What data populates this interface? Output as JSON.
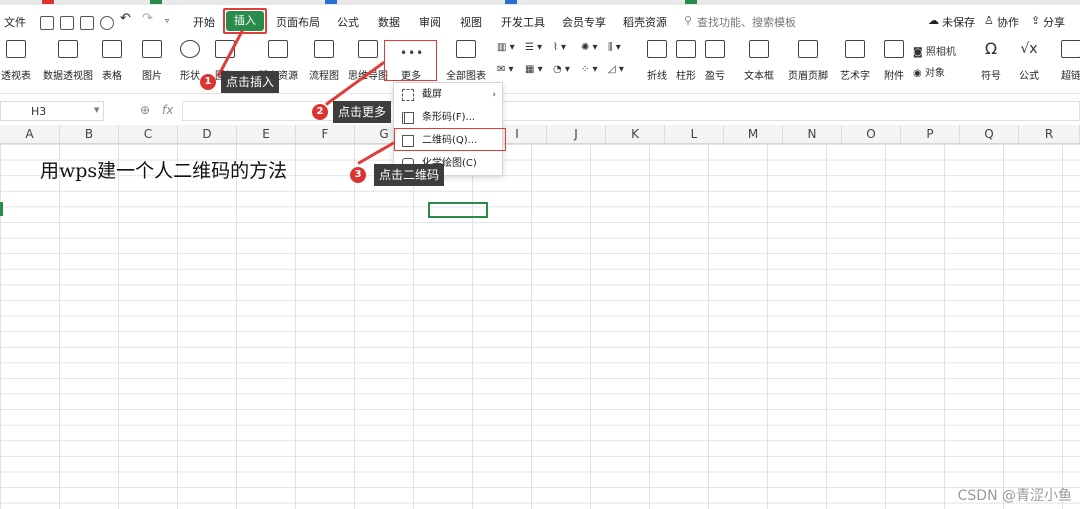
{
  "menu": {
    "file": "文件",
    "start": "开始",
    "insert": "插入",
    "page_layout": "页面布局",
    "formula": "公式",
    "data": "数据",
    "review": "审阅",
    "view": "视图",
    "dev_tools": "开发工具",
    "member": "会员专享",
    "templates": "稻壳资源",
    "search": "查找功能、搜索模板",
    "unsaved": "未保存",
    "collab": "协作",
    "share": "分享"
  },
  "ribbon": {
    "pivot_table": "透视表",
    "pivot_chart": "数据透视图",
    "table": "表格",
    "picture": "图片",
    "shape": "形状",
    "icon": "图标",
    "material": "稻壳资源",
    "flowchart": "流程图",
    "mindmap": "思维导图",
    "more": "更多",
    "all_charts": "全部图表",
    "line": "折线",
    "column": "柱形",
    "win_loss": "盈亏",
    "textbox": "文本框",
    "header_footer": "页眉页脚",
    "wordart": "艺术字",
    "attachment": "附件",
    "camera": "照相机",
    "object": "对象",
    "symbol": "符号",
    "equation": "公式",
    "hyperlink": "超链"
  },
  "formula_bar": {
    "cell_ref": "H3",
    "fx": "fx"
  },
  "columns": [
    "A",
    "B",
    "C",
    "D",
    "E",
    "F",
    "G",
    "H",
    "I",
    "J",
    "K",
    "L",
    "M",
    "N",
    "O",
    "P",
    "Q",
    "R"
  ],
  "cell_title": "用wps建一个人二维码的方法",
  "dropdown": {
    "screenshot": "截屏",
    "barcode": "条形码(F)...",
    "qrcode": "二维码(Q)...",
    "chem": "化学绘图(C)"
  },
  "annotations": [
    {
      "num": "1",
      "text": "点击插入"
    },
    {
      "num": "2",
      "text": "点击更多"
    },
    {
      "num": "3",
      "text": "点击二维码"
    }
  ],
  "watermark": "CSDN @青涩小鱼",
  "colors": {
    "accent": "#2a8c4a",
    "highlight": "#e03c3c"
  }
}
